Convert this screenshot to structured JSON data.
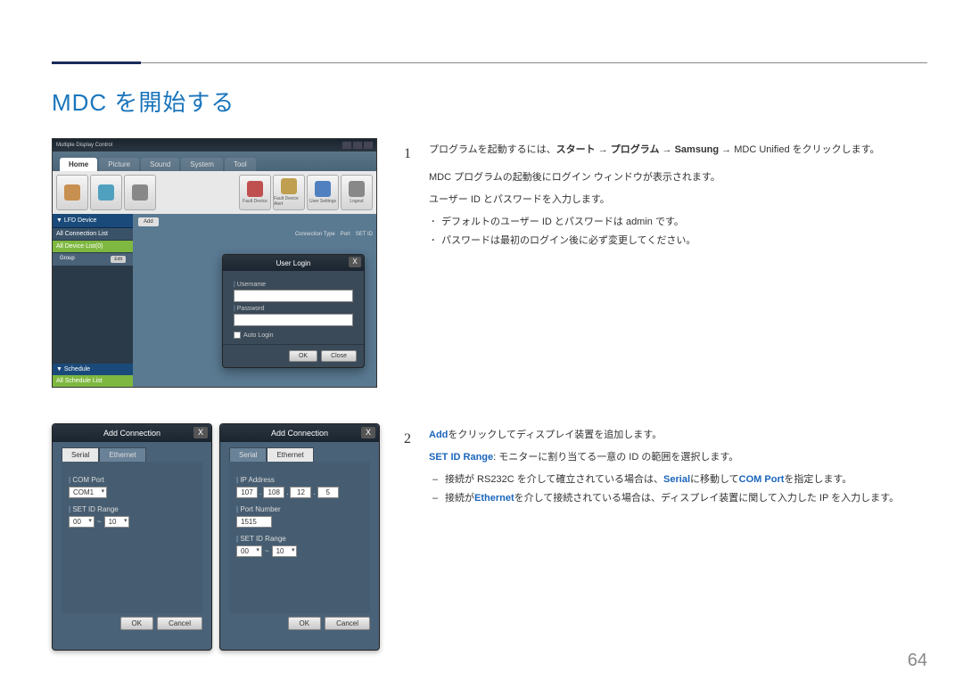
{
  "page": {
    "title": "MDC を開始する",
    "number": "64"
  },
  "screenshot1": {
    "window_title": "Multiple Display Control",
    "tabs": [
      "Home",
      "Picture",
      "Sound",
      "System",
      "Tool"
    ],
    "toolbar_left": [
      "",
      "",
      ""
    ],
    "toolbar_right_labels": [
      "Fault Device",
      "Fault Device Alert",
      "User Settings",
      "Logout"
    ],
    "sidebar": {
      "header": "▼ LFD Device",
      "item_all_conn": "All Connection List",
      "item_all_list": "All Device List(0)",
      "group_label": "Group",
      "edit_btn": "Edit",
      "sched_hdr": "▼ Schedule",
      "sched_list": "All Schedule List"
    },
    "add_button": "Add",
    "columns": [
      "Connection Type",
      "Port",
      "SET ID"
    ],
    "login": {
      "title": "User Login",
      "username_label": "Username",
      "password_label": "Password",
      "auto_login": "Auto Login",
      "ok": "OK",
      "close": "Close"
    }
  },
  "conn_dialog": {
    "title": "Add Connection",
    "tab_serial": "Serial",
    "tab_ethernet": "Ethernet",
    "com_port_label": "COM Port",
    "com_port_value": "COM1",
    "set_id_label": "SET ID Range",
    "range_from": "00",
    "range_to": "10",
    "ip_label": "IP Address",
    "ip_segments": [
      "107",
      "108",
      "12",
      "5"
    ],
    "port_label": "Port Number",
    "port_value": "1515",
    "ok": "OK",
    "cancel": "Cancel"
  },
  "instructions": {
    "step1": {
      "num": "1",
      "main": "プログラムを起動するには、",
      "path1": "スタート",
      "arrow": " → ",
      "path2": "プログラム",
      "path3": "Samsung",
      "path4": "MDC Unified",
      "tail": " をクリックします。",
      "line2": "MDC プログラムの起動後にログイン ウィンドウが表示されます。",
      "line3": "ユーザー ID とパスワードを入力します。",
      "bullet1": "デフォルトのユーザー ID とパスワードは admin です。",
      "bullet2": "パスワードは最初のログイン後に必ず変更してください。"
    },
    "step2": {
      "num": "2",
      "add_kw": "Add",
      "add_tail": "をクリックしてディスプレイ装置を追加します。",
      "setid_kw": "SET ID Range",
      "setid_tail": ": モニターに割り当てる一意の ID の範囲を選択します。",
      "dash1_pre": "接続が RS232C を介して確立されている場合は、",
      "dash1_kw1": "Serial",
      "dash1_mid": "に移動して",
      "dash1_kw2": "COM Port",
      "dash1_tail": "を指定します。",
      "dash2_pre": "接続が",
      "dash2_kw": "Ethernet",
      "dash2_tail": "を介して接続されている場合は、ディスプレイ装置に関して入力した IP を入力します。"
    }
  }
}
